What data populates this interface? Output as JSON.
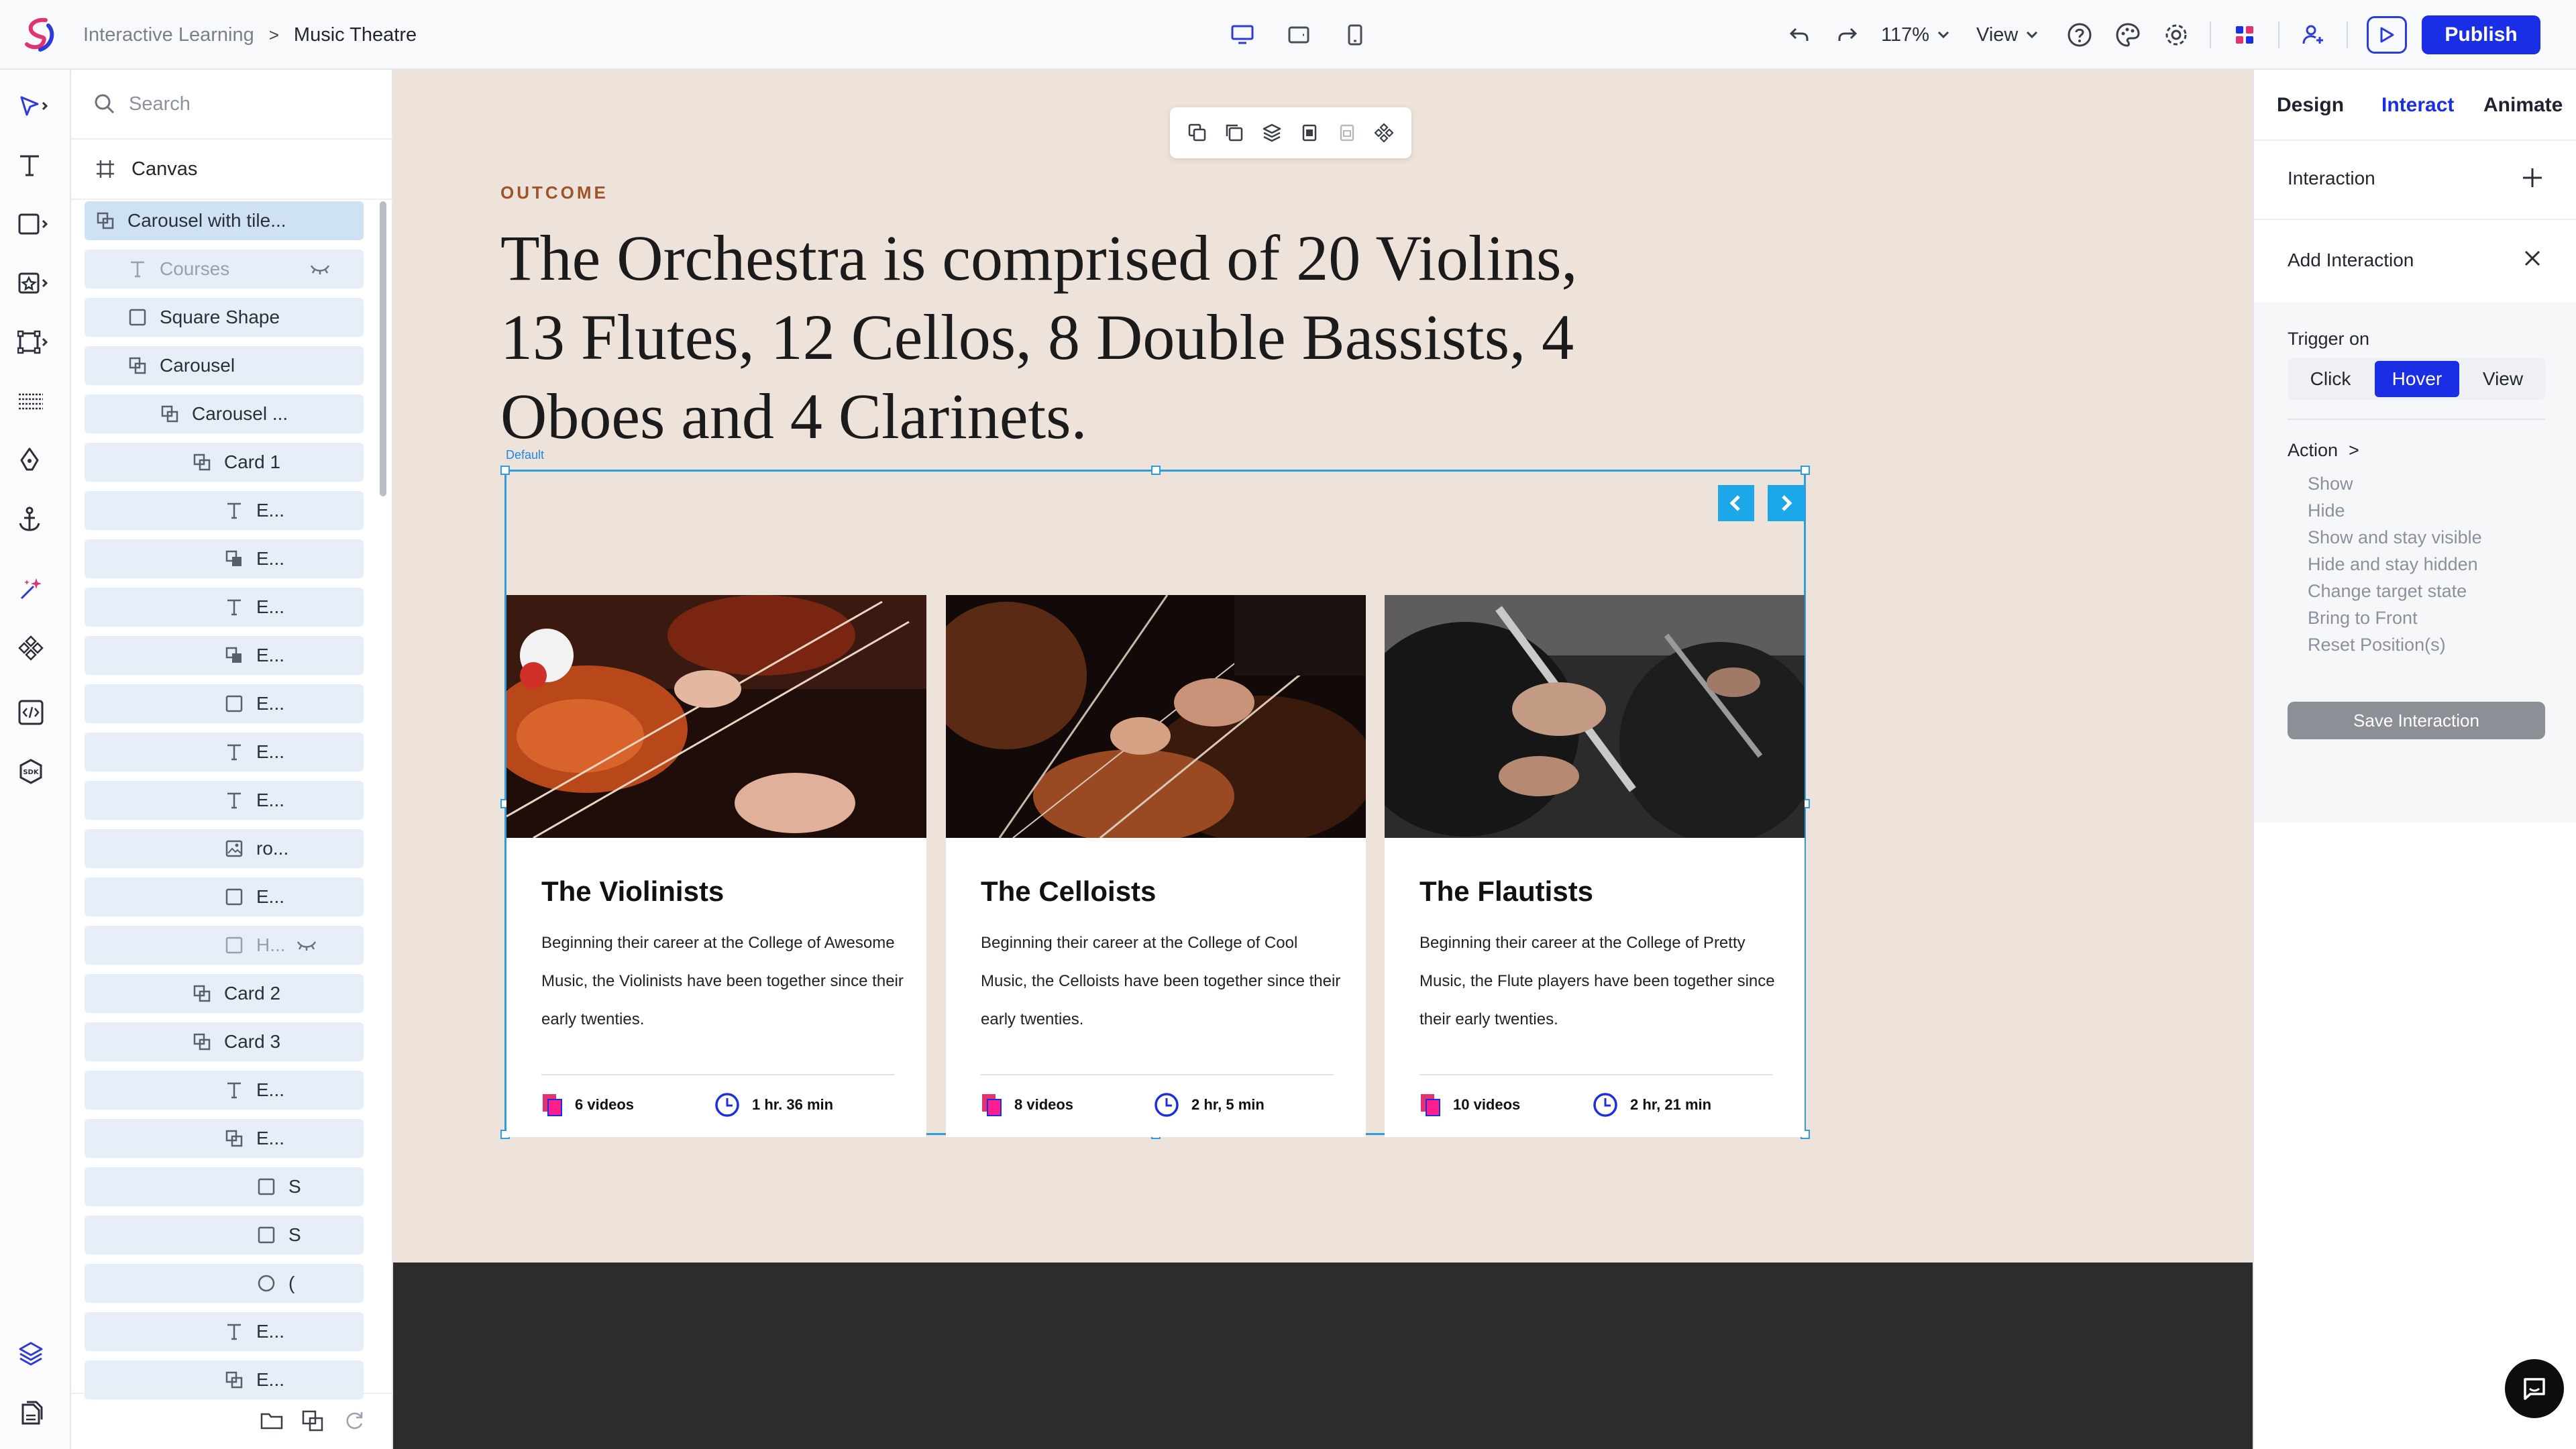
{
  "header": {
    "breadcrumb_parent": "Interactive Learning",
    "breadcrumb_sep": ">",
    "breadcrumb_current": "Music Theatre",
    "zoom": "117%",
    "view_label": "View",
    "publish_label": "Publish"
  },
  "layers": {
    "search_placeholder": "Search",
    "canvas_label": "Canvas",
    "items": [
      {
        "label": "Carousel with tile..."
      },
      {
        "label": "Courses"
      },
      {
        "label": "Square Shape"
      },
      {
        "label": "Carousel"
      },
      {
        "label": "Carousel ..."
      },
      {
        "label": "Card 1"
      },
      {
        "label": "E..."
      },
      {
        "label": "E..."
      },
      {
        "label": "E..."
      },
      {
        "label": "E..."
      },
      {
        "label": "E..."
      },
      {
        "label": "E..."
      },
      {
        "label": "E..."
      },
      {
        "label": "ro..."
      },
      {
        "label": "E..."
      },
      {
        "label": "H..."
      },
      {
        "label": "Card 2"
      },
      {
        "label": "Card 3"
      },
      {
        "label": "E..."
      },
      {
        "label": "E..."
      },
      {
        "label": "S"
      },
      {
        "label": "S"
      },
      {
        "label": "("
      },
      {
        "label": "E..."
      },
      {
        "label": "E..."
      }
    ]
  },
  "stage": {
    "eyebrow": "OUTCOME",
    "headline": "The Orchestra is comprised of 20 Violins, 13 Flutes, 12 Cellos, 8 Double Bassists, 4 Oboes and 4 Clarinets.",
    "state_label": "Default",
    "cards": [
      {
        "title": "The Violinists",
        "description": "Beginning their career at the College of Awesome Music, the Violinists have been together since their early twenties.",
        "videos": "6 videos",
        "duration": "1 hr. 36 min"
      },
      {
        "title": "The Celloists",
        "description": "Beginning their career at the College of Cool Music, the Celloists have been together since their early twenties.",
        "videos": "8 videos",
        "duration": "2 hr, 5 min"
      },
      {
        "title": "The Flautists",
        "description": "Beginning their career at the College of Pretty Music, the Flute players have been together since their early twenties.",
        "videos": "10 videos",
        "duration": "2 hr, 21 min"
      }
    ]
  },
  "right_panel": {
    "tabs": [
      "Design",
      "Interact",
      "Animate"
    ],
    "active_tab": "Interact",
    "interaction_label": "Interaction",
    "add_interaction_label": "Add Interaction",
    "trigger_label": "Trigger on",
    "triggers": [
      "Click",
      "Hover",
      "View"
    ],
    "active_trigger": "Hover",
    "action_label": "Action",
    "action_chevron": ">",
    "actions": [
      "Show",
      "Hide",
      "Show and stay visible",
      "Hide and stay hidden",
      "Change target state",
      "Bring to Front",
      "Reset Position(s)"
    ],
    "save_label": "Save Interaction"
  },
  "colors": {
    "accent": "#1a2ee6",
    "selection": "#2f9be0",
    "stage_bg": "#ede3da",
    "eyebrow": "#a0532a",
    "layer_bg": "#e6eef7"
  }
}
